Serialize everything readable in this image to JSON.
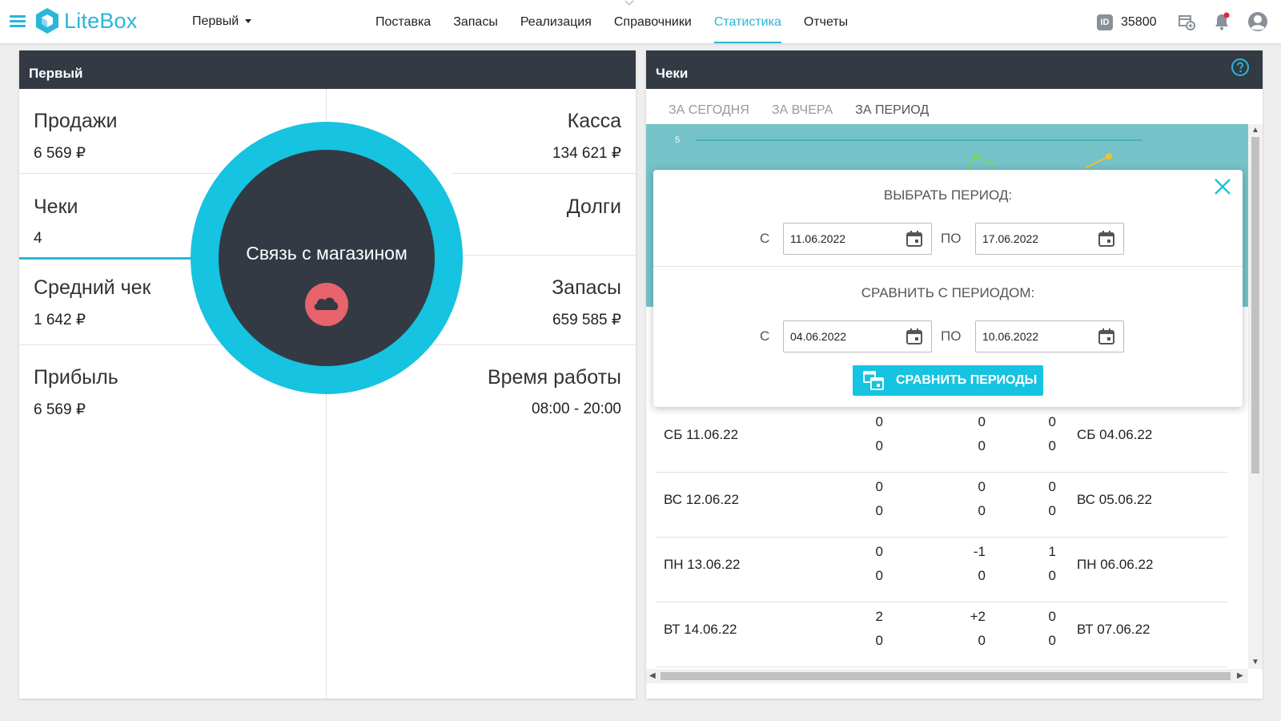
{
  "header": {
    "logo_text": "LiteBox",
    "store_name": "Первый",
    "nav": [
      {
        "label": "Поставка"
      },
      {
        "label": "Запасы"
      },
      {
        "label": "Реализация"
      },
      {
        "label": "Справочники"
      },
      {
        "label": "Статистика"
      },
      {
        "label": "Отчеты"
      }
    ],
    "id_label": "ID",
    "id_value": "35800"
  },
  "left_panel": {
    "title": "Первый",
    "stats": {
      "sales": {
        "label": "Продажи",
        "value": "6 569 ₽"
      },
      "cash": {
        "label": "Касса",
        "value": "134 621 ₽"
      },
      "checks": {
        "label": "Чеки",
        "value": "4"
      },
      "debts": {
        "label": "Долги",
        "value": ""
      },
      "avg_check": {
        "label": "Средний чек",
        "value": "1 642 ₽"
      },
      "stock": {
        "label": "Запасы",
        "value": "659 585 ₽"
      },
      "profit": {
        "label": "Прибыль",
        "value": "6 569 ₽"
      },
      "work_time": {
        "label": "Время работы",
        "value": "08:00 - 20:00"
      }
    },
    "connection_overlay": {
      "text": "Связь с магазином"
    }
  },
  "right_panel": {
    "title": "Чеки",
    "tabs": [
      {
        "label": "ЗА СЕГОДНЯ"
      },
      {
        "label": "ЗА ВЧЕРА"
      },
      {
        "label": "ЗА ПЕРИОД"
      }
    ],
    "chart": {
      "y_tick": "5"
    },
    "rows": [
      {
        "date": "СБ 11.06.22",
        "compare_date": "СБ 04.06.22",
        "c1": [
          "0",
          "0"
        ],
        "c2": [
          "0",
          "0"
        ],
        "c3": [
          "0",
          "0"
        ]
      },
      {
        "date": "ВС 12.06.22",
        "compare_date": "ВС 05.06.22",
        "c1": [
          "0",
          "0"
        ],
        "c2": [
          "0",
          "0"
        ],
        "c3": [
          "0",
          "0"
        ]
      },
      {
        "date": "ПН 13.06.22",
        "compare_date": "ПН 06.06.22",
        "c1": [
          "0",
          "0"
        ],
        "c2": [
          "-1",
          "0"
        ],
        "c3": [
          "1",
          "0"
        ]
      },
      {
        "date": "ВТ 14.06.22",
        "compare_date": "ВТ 07.06.22",
        "c1": [
          "2",
          "0"
        ],
        "c2": [
          "+2",
          "0"
        ],
        "c3": [
          "0",
          "0"
        ]
      }
    ]
  },
  "period_modal": {
    "title": "ВЫБРАТЬ ПЕРИОД:",
    "from_label": "С",
    "to_label": "ПО",
    "from_date": "11.06.2022",
    "to_date": "17.06.2022",
    "compare_title": "СРАВНИТЬ С ПЕРИОДОМ:",
    "compare_from_date": "04.06.2022",
    "compare_to_date": "10.06.2022",
    "compare_button": "СРАВНИТЬ ПЕРИОДЫ"
  },
  "colors": {
    "accent": "#29b6d8",
    "header_dark": "#333a44",
    "chart_bg": "#75c2c9",
    "cloud_red": "#e8636c",
    "ring": "#16c3e0"
  },
  "icons": [
    "menu-icon",
    "litebox-logo-icon",
    "id-icon",
    "store-add-icon",
    "bell-icon",
    "user-icon",
    "help-icon",
    "close-icon",
    "calendar-icon",
    "cloud-icon",
    "compare-icon"
  ]
}
